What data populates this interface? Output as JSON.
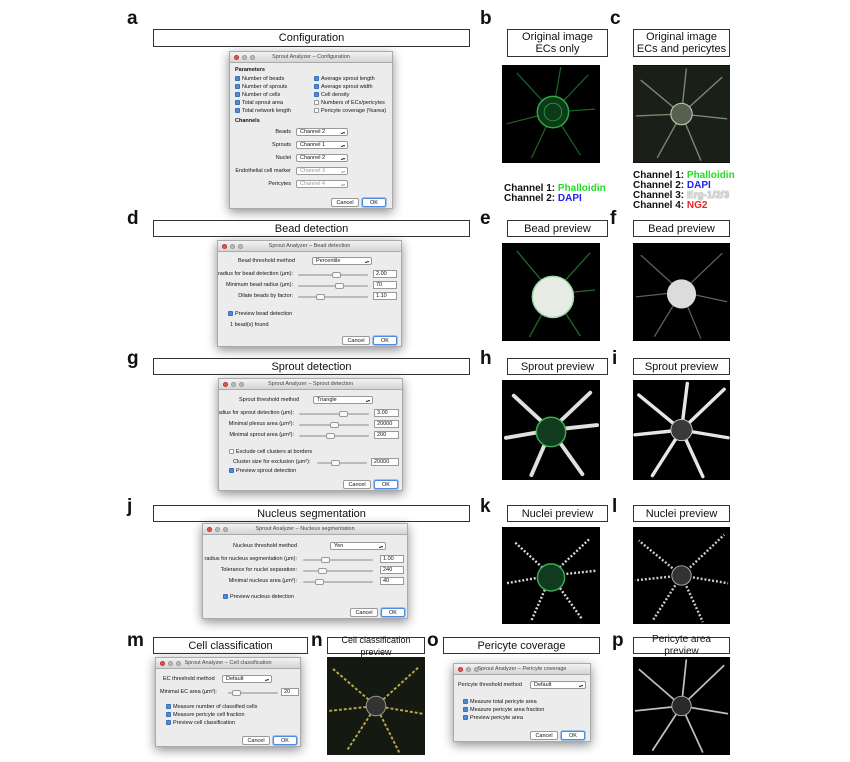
{
  "labels": {
    "a": "a",
    "b": "b",
    "c": "c",
    "d": "d",
    "e": "e",
    "f": "f",
    "g": "g",
    "h": "h",
    "i": "i",
    "j": "j",
    "k": "k",
    "l": "l",
    "m": "m",
    "n": "n",
    "o": "o",
    "p": "p"
  },
  "headers": {
    "configuration": "Configuration",
    "original_ecs": "Original image\nECs only",
    "original_ecs_pericytes": "Original image\nECs and pericytes",
    "bead_detection": "Bead detection",
    "bead_preview": "Bead preview",
    "sprout_detection": "Sprout detection",
    "sprout_preview": "Sprout preview",
    "nucleus_segmentation": "Nucleus segmentation",
    "nuclei_preview": "Nuclei preview",
    "cell_classification": "Cell classification",
    "cell_classification_preview": "Cell classification preview",
    "pericyte_coverage": "Pericyte coverage",
    "pericyte_area_preview": "Pericyte area preview"
  },
  "channels_b": [
    {
      "prefix": "Channel 1: ",
      "name": "Phalloidin",
      "color": "#22dd22"
    },
    {
      "prefix": "Channel 2: ",
      "name": "DAPI",
      "color": "#2222ee"
    }
  ],
  "channels_c": [
    {
      "prefix": "Channel 1: ",
      "name": "Phalloidin",
      "color": "#22dd22"
    },
    {
      "prefix": "Channel 2: ",
      "name": "DAPI",
      "color": "#2222ee"
    },
    {
      "prefix": "Channel 3: ",
      "name": "Erg-1/2/3",
      "color": "#dddddd"
    },
    {
      "prefix": "Channel 4: ",
      "name": "NG2",
      "color": "#ee2222"
    }
  ],
  "config": {
    "title": "Sprout Analyzer – Configuration",
    "parameters_label": "Parameters",
    "params_left": [
      {
        "label": "Number of beads",
        "checked": true
      },
      {
        "label": "Number of sprouts",
        "checked": true
      },
      {
        "label": "Number of cells",
        "checked": true
      },
      {
        "label": "Total sprout area",
        "checked": true
      },
      {
        "label": "Total network length",
        "checked": true
      }
    ],
    "params_right": [
      {
        "label": "Average sprout length",
        "checked": true
      },
      {
        "label": "Average sprout width",
        "checked": true
      },
      {
        "label": "Cell density",
        "checked": true
      },
      {
        "label": "Numbers of ECs/pericytes",
        "checked": false
      },
      {
        "label": "Pericyte coverage (%area)",
        "checked": false
      }
    ],
    "channels_label": "Channels",
    "channels": [
      {
        "label": "Beads",
        "value": "Channel 2",
        "disabled": false
      },
      {
        "label": "Sprouts",
        "value": "Channel 1",
        "disabled": false
      },
      {
        "label": "Nuclei",
        "value": "Channel 2",
        "disabled": false
      },
      {
        "label": "Endothelial cell marker",
        "value": "Channel 3",
        "disabled": true
      },
      {
        "label": "Pericytes",
        "value": "Channel 4",
        "disabled": true
      }
    ],
    "cancel": "Cancel",
    "ok": "OK"
  },
  "bead": {
    "title": "Sprout Analyzer – Bead detection",
    "method_label": "Bead threshold method",
    "method_value": "Percentile",
    "fields": [
      {
        "label": "Blur radius for bead detection (µm):",
        "value": "2.00",
        "knob": 0.55
      },
      {
        "label": "Minimum bead radius (µm):",
        "value": "70",
        "knob": 0.6
      },
      {
        "label": "Dilate beads by factor:",
        "value": "1.10",
        "knob": 0.3
      }
    ],
    "preview_label": "Preview bead detection",
    "found": "1 bead(s) found",
    "cancel": "Cancel",
    "ok": "OK"
  },
  "sprout": {
    "title": "Sprout Analyzer – Sprout detection",
    "method_label": "Sprout threshold method",
    "method_value": "Triangle",
    "fields": [
      {
        "label": "Blur radius for sprout detection (µm):",
        "value": "3.00",
        "knob": 0.65
      },
      {
        "label": "Minimal plexus area (µm²):",
        "value": "20000",
        "knob": 0.5
      },
      {
        "label": "Minimal sprout area (µm²):",
        "value": "200",
        "knob": 0.45
      }
    ],
    "exclude_label": "Exclude cell clusters at borders",
    "cluster_label": "Cluster size for exclusion (µm²):",
    "cluster_value": "20000",
    "preview_label": "Preview sprout detection",
    "cancel": "Cancel",
    "ok": "OK"
  },
  "nucleus": {
    "title": "Sprout Analyzer – Nucleus segmentation",
    "method_label": "Nucleus threshold method",
    "method_value": "Yen",
    "fields": [
      {
        "label": "Blur radius for nucleus segmentation (µm):",
        "value": "1.00",
        "knob": 0.3
      },
      {
        "label": "Tolerance for nuclei separation:",
        "value": "240",
        "knob": 0.25
      },
      {
        "label": "Minimal nucleus area (µm²):",
        "value": "40",
        "knob": 0.2
      }
    ],
    "preview_label": "Preview nucleus detection",
    "cancel": "Cancel",
    "ok": "OK"
  },
  "cellclass": {
    "title": "Sprout Analyzer – Cell classification",
    "method_label": "EC threshold method",
    "method_value": "Default",
    "field_label": "Minimal EC area (µm²):",
    "field_value": "20",
    "checks": [
      "Measure number of classified cells",
      "Measure pericyte cell fraction",
      "Preview cell classification"
    ],
    "cancel": "Cancel",
    "ok": "OK"
  },
  "pericyte": {
    "title": "Sprout Analyzer – Pericyte coverage",
    "method_label": "Pericyte threshold method",
    "method_value": "Default",
    "checks": [
      "Measure total pericyte area",
      "Measure pericyte area fraction",
      "Preview pericyte area"
    ],
    "cancel": "Cancel",
    "ok": "OK"
  }
}
